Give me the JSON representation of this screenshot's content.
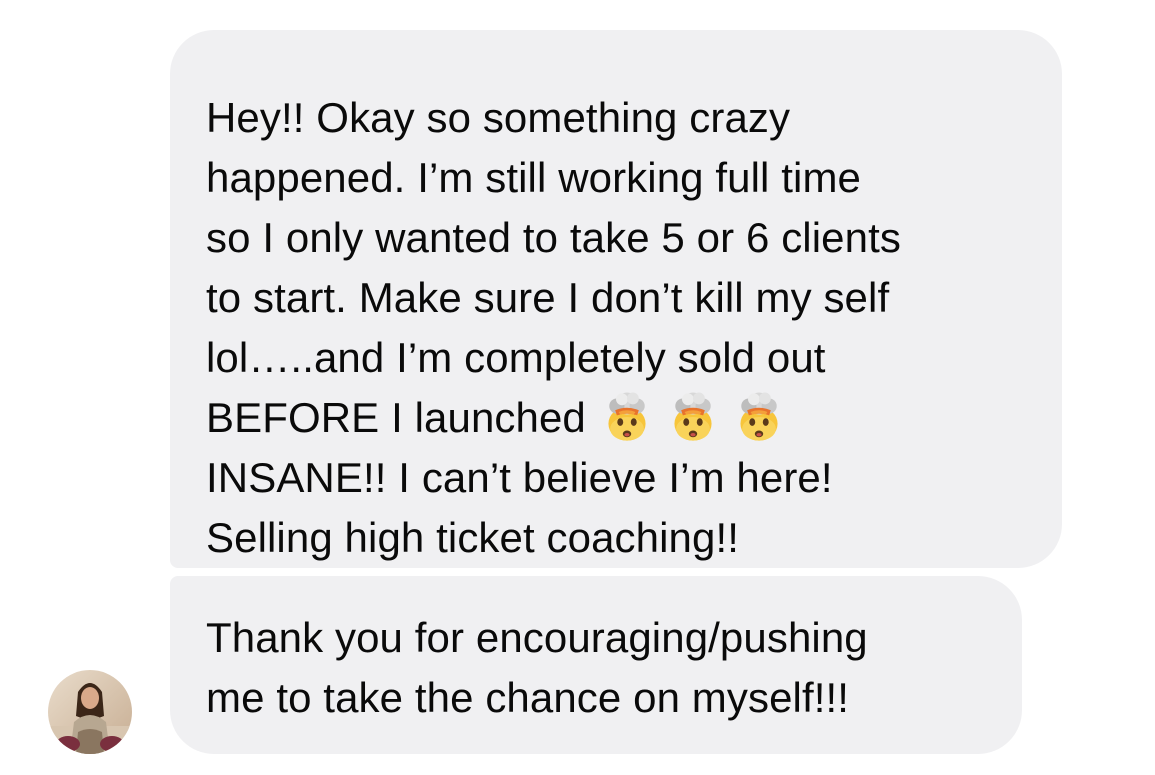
{
  "messages": [
    {
      "lines": [
        "Hey!! Okay so something crazy",
        "happened. I’m still working full time",
        "so I only wanted to take 5 or 6 clients",
        "to start. Make sure I don’t kill my self",
        "lol…..and I’m completely sold out",
        "BEFORE I launched",
        "INSANE!! I can’t believe I’m here!",
        "Selling high ticket coaching!!"
      ],
      "emojis": [
        "exploding-head-emoji",
        "exploding-head-emoji",
        "exploding-head-emoji"
      ]
    },
    {
      "lines": [
        "Thank you for encouraging/pushing",
        "me to take the chance on myself!!!"
      ]
    }
  ],
  "sender": {
    "avatar_icon": "avatar-photo"
  },
  "colors": {
    "bubble": "#f0f0f2",
    "text": "#0a0a0a",
    "background": "#ffffff"
  }
}
